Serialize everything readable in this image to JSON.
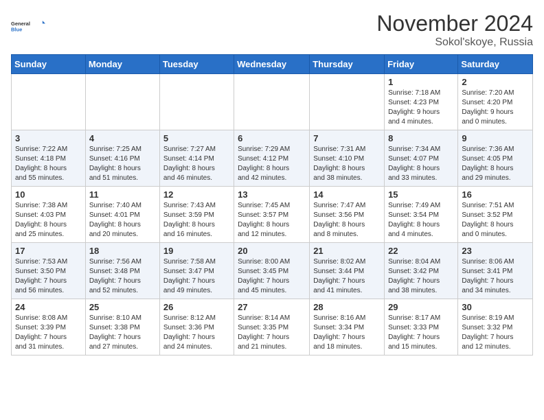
{
  "logo": {
    "general": "General",
    "blue": "Blue"
  },
  "title": "November 2024",
  "location": "Sokol'skoye, Russia",
  "days_header": [
    "Sunday",
    "Monday",
    "Tuesday",
    "Wednesday",
    "Thursday",
    "Friday",
    "Saturday"
  ],
  "weeks": [
    [
      {
        "day": "",
        "info": ""
      },
      {
        "day": "",
        "info": ""
      },
      {
        "day": "",
        "info": ""
      },
      {
        "day": "",
        "info": ""
      },
      {
        "day": "",
        "info": ""
      },
      {
        "day": "1",
        "info": "Sunrise: 7:18 AM\nSunset: 4:23 PM\nDaylight: 9 hours\nand 4 minutes."
      },
      {
        "day": "2",
        "info": "Sunrise: 7:20 AM\nSunset: 4:20 PM\nDaylight: 9 hours\nand 0 minutes."
      }
    ],
    [
      {
        "day": "3",
        "info": "Sunrise: 7:22 AM\nSunset: 4:18 PM\nDaylight: 8 hours\nand 55 minutes."
      },
      {
        "day": "4",
        "info": "Sunrise: 7:25 AM\nSunset: 4:16 PM\nDaylight: 8 hours\nand 51 minutes."
      },
      {
        "day": "5",
        "info": "Sunrise: 7:27 AM\nSunset: 4:14 PM\nDaylight: 8 hours\nand 46 minutes."
      },
      {
        "day": "6",
        "info": "Sunrise: 7:29 AM\nSunset: 4:12 PM\nDaylight: 8 hours\nand 42 minutes."
      },
      {
        "day": "7",
        "info": "Sunrise: 7:31 AM\nSunset: 4:10 PM\nDaylight: 8 hours\nand 38 minutes."
      },
      {
        "day": "8",
        "info": "Sunrise: 7:34 AM\nSunset: 4:07 PM\nDaylight: 8 hours\nand 33 minutes."
      },
      {
        "day": "9",
        "info": "Sunrise: 7:36 AM\nSunset: 4:05 PM\nDaylight: 8 hours\nand 29 minutes."
      }
    ],
    [
      {
        "day": "10",
        "info": "Sunrise: 7:38 AM\nSunset: 4:03 PM\nDaylight: 8 hours\nand 25 minutes."
      },
      {
        "day": "11",
        "info": "Sunrise: 7:40 AM\nSunset: 4:01 PM\nDaylight: 8 hours\nand 20 minutes."
      },
      {
        "day": "12",
        "info": "Sunrise: 7:43 AM\nSunset: 3:59 PM\nDaylight: 8 hours\nand 16 minutes."
      },
      {
        "day": "13",
        "info": "Sunrise: 7:45 AM\nSunset: 3:57 PM\nDaylight: 8 hours\nand 12 minutes."
      },
      {
        "day": "14",
        "info": "Sunrise: 7:47 AM\nSunset: 3:56 PM\nDaylight: 8 hours\nand 8 minutes."
      },
      {
        "day": "15",
        "info": "Sunrise: 7:49 AM\nSunset: 3:54 PM\nDaylight: 8 hours\nand 4 minutes."
      },
      {
        "day": "16",
        "info": "Sunrise: 7:51 AM\nSunset: 3:52 PM\nDaylight: 8 hours\nand 0 minutes."
      }
    ],
    [
      {
        "day": "17",
        "info": "Sunrise: 7:53 AM\nSunset: 3:50 PM\nDaylight: 7 hours\nand 56 minutes."
      },
      {
        "day": "18",
        "info": "Sunrise: 7:56 AM\nSunset: 3:48 PM\nDaylight: 7 hours\nand 52 minutes."
      },
      {
        "day": "19",
        "info": "Sunrise: 7:58 AM\nSunset: 3:47 PM\nDaylight: 7 hours\nand 49 minutes."
      },
      {
        "day": "20",
        "info": "Sunrise: 8:00 AM\nSunset: 3:45 PM\nDaylight: 7 hours\nand 45 minutes."
      },
      {
        "day": "21",
        "info": "Sunrise: 8:02 AM\nSunset: 3:44 PM\nDaylight: 7 hours\nand 41 minutes."
      },
      {
        "day": "22",
        "info": "Sunrise: 8:04 AM\nSunset: 3:42 PM\nDaylight: 7 hours\nand 38 minutes."
      },
      {
        "day": "23",
        "info": "Sunrise: 8:06 AM\nSunset: 3:41 PM\nDaylight: 7 hours\nand 34 minutes."
      }
    ],
    [
      {
        "day": "24",
        "info": "Sunrise: 8:08 AM\nSunset: 3:39 PM\nDaylight: 7 hours\nand 31 minutes."
      },
      {
        "day": "25",
        "info": "Sunrise: 8:10 AM\nSunset: 3:38 PM\nDaylight: 7 hours\nand 27 minutes."
      },
      {
        "day": "26",
        "info": "Sunrise: 8:12 AM\nSunset: 3:36 PM\nDaylight: 7 hours\nand 24 minutes."
      },
      {
        "day": "27",
        "info": "Sunrise: 8:14 AM\nSunset: 3:35 PM\nDaylight: 7 hours\nand 21 minutes."
      },
      {
        "day": "28",
        "info": "Sunrise: 8:16 AM\nSunset: 3:34 PM\nDaylight: 7 hours\nand 18 minutes."
      },
      {
        "day": "29",
        "info": "Sunrise: 8:17 AM\nSunset: 3:33 PM\nDaylight: 7 hours\nand 15 minutes."
      },
      {
        "day": "30",
        "info": "Sunrise: 8:19 AM\nSunset: 3:32 PM\nDaylight: 7 hours\nand 12 minutes."
      }
    ]
  ]
}
